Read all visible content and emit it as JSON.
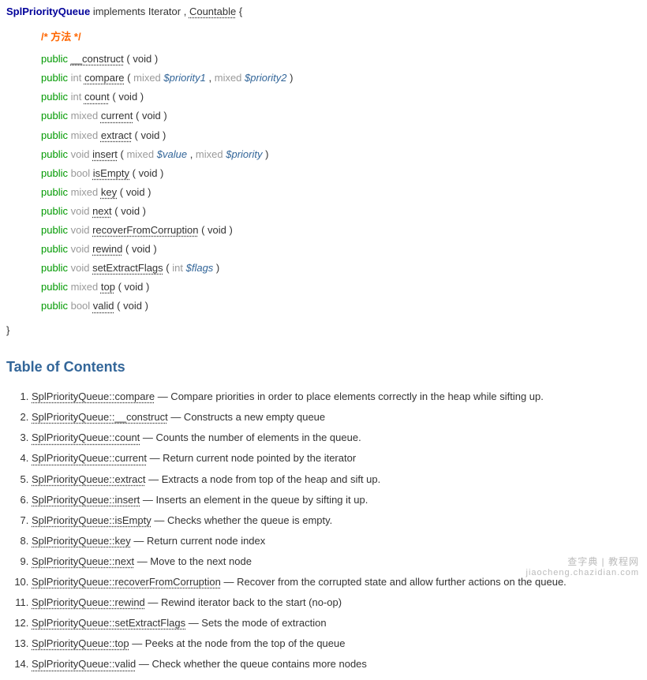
{
  "synopsis": {
    "class_name": "SplPriorityQueue",
    "implements_word": "implements",
    "iterator": "Iterator",
    "countable": "Countable",
    "brace_open": "{",
    "brace_close": "}",
    "methods_comment": "/* 方法 */",
    "methods": [
      {
        "modifier": "public",
        "return": "",
        "name": "__construct",
        "params": "( void )"
      },
      {
        "modifier": "public",
        "return": "int",
        "name": "compare",
        "params_pre": "( ",
        "p1type": "mixed",
        "p1name": "$priority1",
        "sep": " , ",
        "p2type": "mixed",
        "p2name": "$priority2",
        "params_post": " )"
      },
      {
        "modifier": "public",
        "return": "int",
        "name": "count",
        "params": "( void )"
      },
      {
        "modifier": "public",
        "return": "mixed",
        "name": "current",
        "params": "( void )"
      },
      {
        "modifier": "public",
        "return": "mixed",
        "name": "extract",
        "params": "( void )"
      },
      {
        "modifier": "public",
        "return": "void",
        "name": "insert",
        "params_pre": "( ",
        "p1type": "mixed",
        "p1name": "$value",
        "sep": " , ",
        "p2type": "mixed",
        "p2name": "$priority",
        "params_post": " )"
      },
      {
        "modifier": "public",
        "return": "bool",
        "name": "isEmpty",
        "params": "( void )"
      },
      {
        "modifier": "public",
        "return": "mixed",
        "name": "key",
        "params": "( void )"
      },
      {
        "modifier": "public",
        "return": "void",
        "name": "next",
        "params": "( void )"
      },
      {
        "modifier": "public",
        "return": "void",
        "name": "recoverFromCorruption",
        "params": "( void )"
      },
      {
        "modifier": "public",
        "return": "void",
        "name": "rewind",
        "params": "( void )"
      },
      {
        "modifier": "public",
        "return": "void",
        "name": "setExtractFlags",
        "params_pre": "( ",
        "p1type": "int",
        "p1name": "$flags",
        "params_post": " )"
      },
      {
        "modifier": "public",
        "return": "mixed",
        "name": "top",
        "params": "( void )"
      },
      {
        "modifier": "public",
        "return": "bool",
        "name": "valid",
        "params": "( void )"
      }
    ]
  },
  "toc": {
    "heading": "Table of Contents",
    "items": [
      {
        "link": "SplPriorityQueue::compare",
        "desc": " — Compare priorities in order to place elements correctly in the heap while sifting up."
      },
      {
        "link": "SplPriorityQueue::__construct",
        "desc": " — Constructs a new empty queue"
      },
      {
        "link": "SplPriorityQueue::count",
        "desc": " — Counts the number of elements in the queue."
      },
      {
        "link": "SplPriorityQueue::current",
        "desc": " — Return current node pointed by the iterator"
      },
      {
        "link": "SplPriorityQueue::extract",
        "desc": " — Extracts a node from top of the heap and sift up."
      },
      {
        "link": "SplPriorityQueue::insert",
        "desc": " — Inserts an element in the queue by sifting it up."
      },
      {
        "link": "SplPriorityQueue::isEmpty",
        "desc": " — Checks whether the queue is empty."
      },
      {
        "link": "SplPriorityQueue::key",
        "desc": " — Return current node index"
      },
      {
        "link": "SplPriorityQueue::next",
        "desc": " — Move to the next node"
      },
      {
        "link": "SplPriorityQueue::recoverFromCorruption",
        "desc": " — Recover from the corrupted state and allow further actions on the queue."
      },
      {
        "link": "SplPriorityQueue::rewind",
        "desc": " — Rewind iterator back to the start (no-op)"
      },
      {
        "link": "SplPriorityQueue::setExtractFlags",
        "desc": " — Sets the mode of extraction"
      },
      {
        "link": "SplPriorityQueue::top",
        "desc": " — Peeks at the node from the top of the queue"
      },
      {
        "link": "SplPriorityQueue::valid",
        "desc": " — Check whether the queue contains more nodes"
      }
    ]
  },
  "watermark": {
    "line1": "查字典 | 教程网",
    "line2": "jiaocheng.chazidian.com"
  }
}
